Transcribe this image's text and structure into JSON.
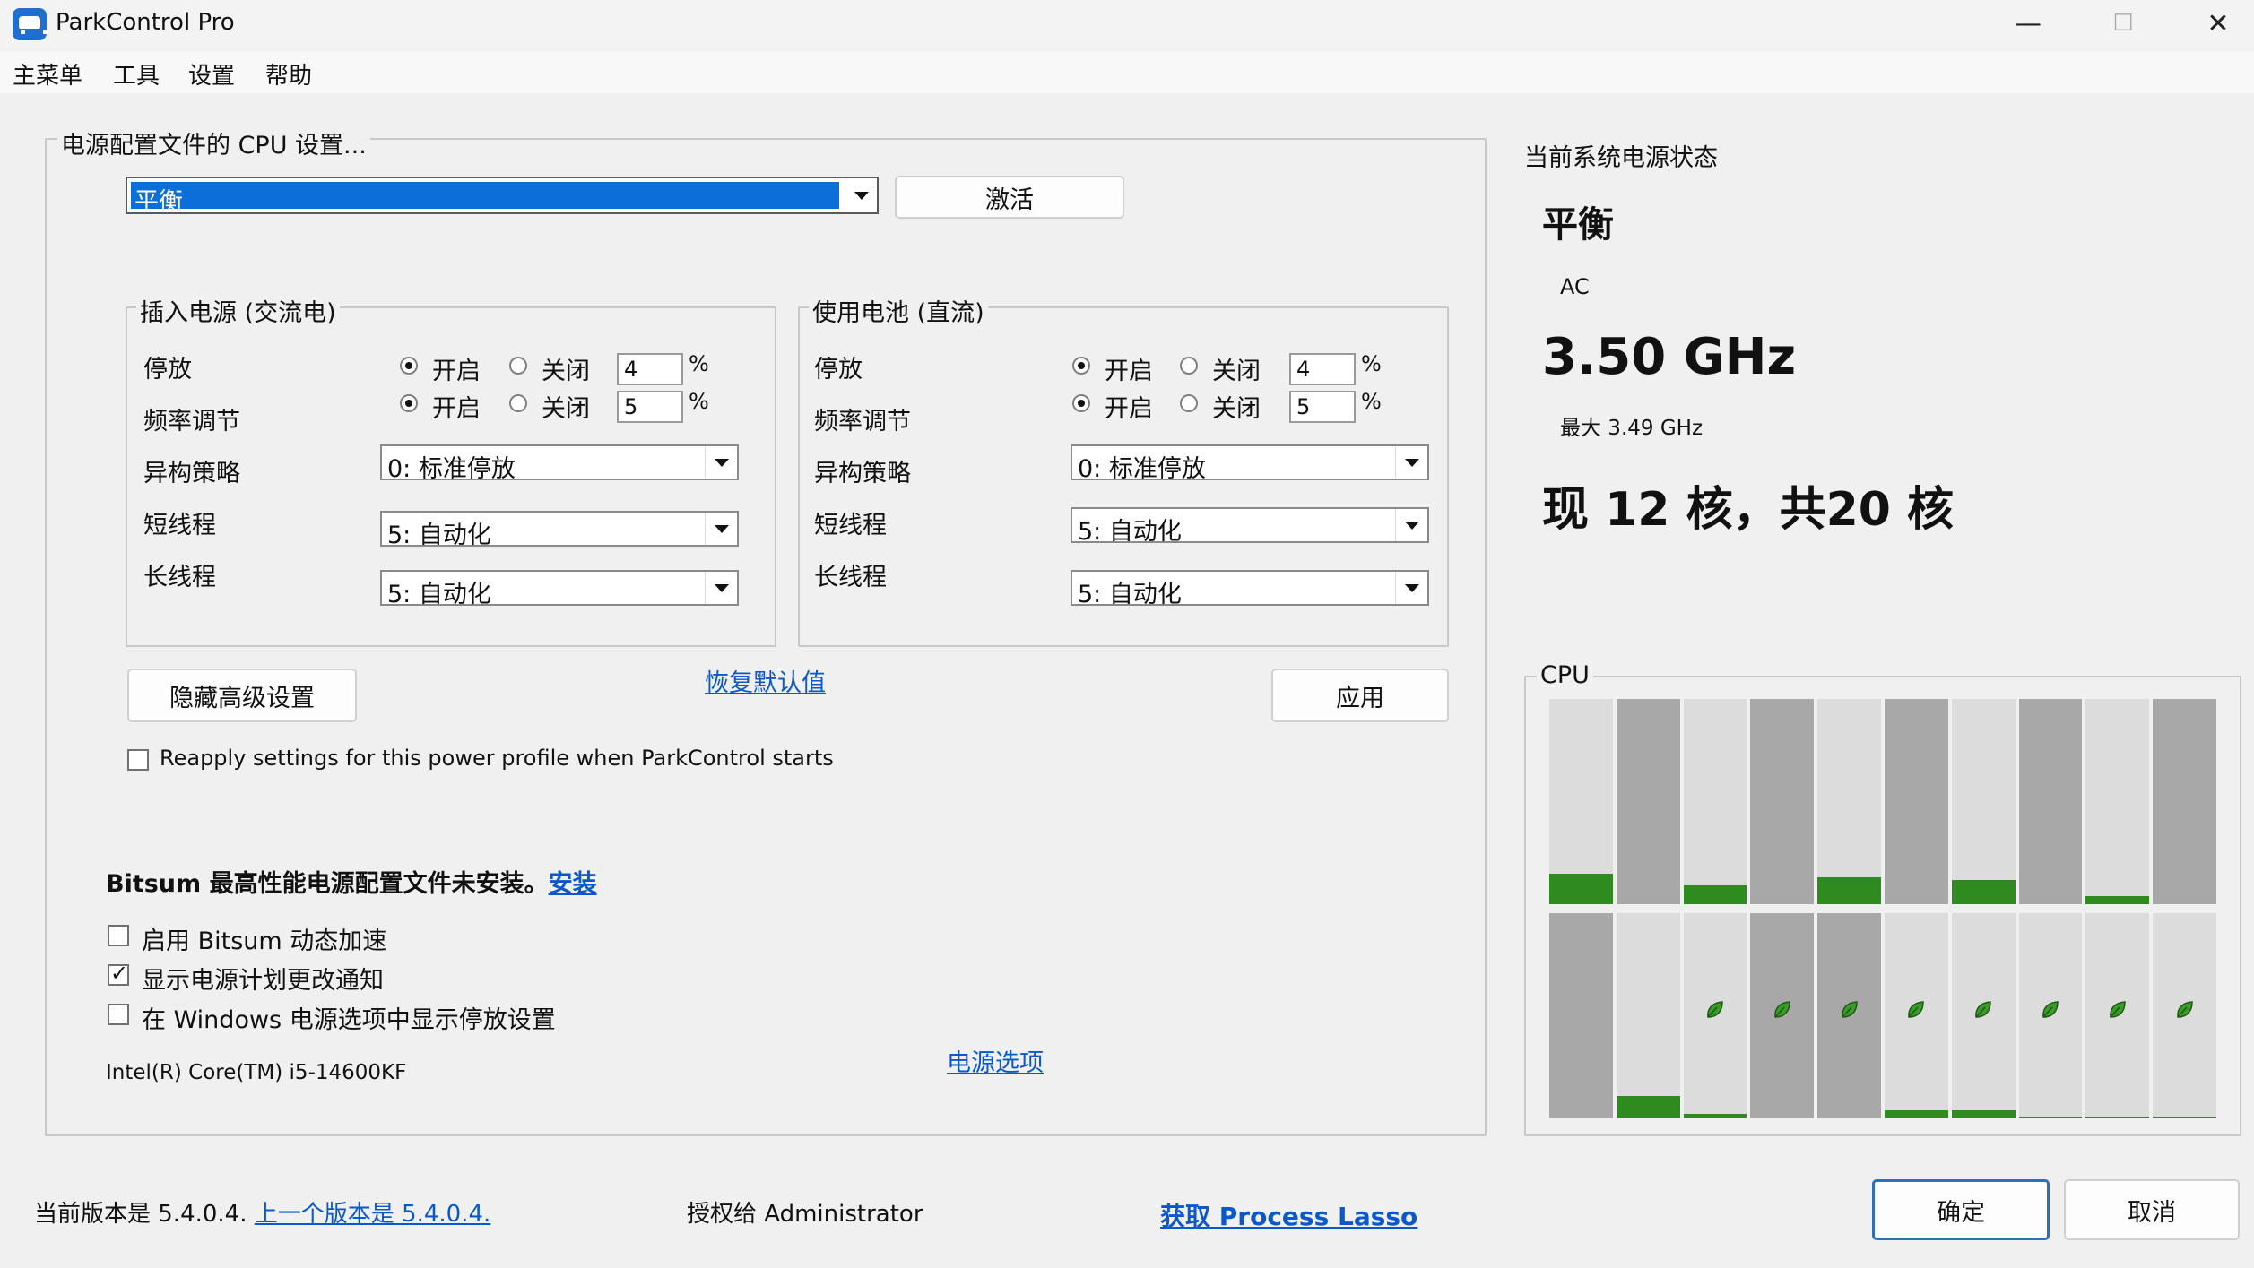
{
  "window": {
    "title": "ParkControl Pro",
    "min_glyph": "—",
    "max_glyph": "☐",
    "close_glyph": "✕"
  },
  "menu": [
    "主菜单",
    "工具",
    "设置",
    "帮助"
  ],
  "profile_group": {
    "legend": "电源配置文件的 CPU 设置...",
    "selected_profile": "平衡",
    "activate_label": "激活"
  },
  "ac_panel": {
    "legend": "插入电源 (交流电)",
    "rows": {
      "parking": "停放",
      "freq": "频率调节",
      "hetero": "异构策略",
      "short": "短线程",
      "long": "长线程"
    },
    "on_label": "开启",
    "off_label": "关闭",
    "parking_value": "4",
    "freq_value": "5",
    "pct": "%",
    "hetero_value": "0: 标准停放",
    "short_value": "5: 自动化",
    "long_value": "5: 自动化"
  },
  "dc_panel": {
    "legend": "使用电池 (直流)",
    "rows": {
      "parking": "停放",
      "freq": "频率调节",
      "hetero": "异构策略",
      "short": "短线程",
      "long": "长线程"
    },
    "on_label": "开启",
    "off_label": "关闭",
    "parking_value": "4",
    "freq_value": "5",
    "pct": "%",
    "hetero_value": "0: 标准停放",
    "short_value": "5: 自动化",
    "long_value": "5: 自动化"
  },
  "actions": {
    "hide_advanced": "隐藏高级设置",
    "restore_defaults": "恢复默认值",
    "apply": "应用",
    "reapply_checkbox": "Reapply settings for this power profile when ParkControl starts"
  },
  "bitsum": {
    "notice": "Bitsum 最高性能电源配置文件未安装。",
    "install_link": "安装",
    "dynamic_boost": "启用 Bitsum 动态加速",
    "show_notify": "显示电源计划更改通知",
    "show_windows": "在 Windows 电源选项中显示停放设置",
    "cpu_name": "Intel(R) Core(TM) i5-14600KF",
    "power_options_link": "电源选项"
  },
  "status": {
    "heading": "当前系统电源状态",
    "plan": "平衡",
    "source": "AC",
    "freq": "3.50 GHz",
    "max_freq": "最大 3.49 GHz",
    "cores": "现 12 核，共20 核"
  },
  "cpu_graph": {
    "legend": "CPU",
    "top_row": [
      {
        "parked": false,
        "load": 0.15
      },
      {
        "parked": true,
        "load": 0.0
      },
      {
        "parked": false,
        "load": 0.09
      },
      {
        "parked": true,
        "load": 0.0
      },
      {
        "parked": false,
        "load": 0.13
      },
      {
        "parked": true,
        "load": 0.0
      },
      {
        "parked": false,
        "load": 0.12
      },
      {
        "parked": true,
        "load": 0.0
      },
      {
        "parked": false,
        "load": 0.04
      },
      {
        "parked": true,
        "load": 0.0
      }
    ],
    "bottom_row": [
      {
        "parked": true,
        "load": 0.0,
        "eco": false
      },
      {
        "parked": false,
        "load": 0.11,
        "eco": false
      },
      {
        "parked": false,
        "load": 0.02,
        "eco": true
      },
      {
        "parked": true,
        "load": 0.0,
        "eco": true
      },
      {
        "parked": true,
        "load": 0.0,
        "eco": true
      },
      {
        "parked": false,
        "load": 0.04,
        "eco": true
      },
      {
        "parked": false,
        "load": 0.04,
        "eco": true
      },
      {
        "parked": false,
        "load": 0.01,
        "eco": true
      },
      {
        "parked": false,
        "load": 0.01,
        "eco": true
      },
      {
        "parked": false,
        "load": 0.01,
        "eco": true
      }
    ],
    "colors": {
      "idle": "#dcdcdc",
      "parked": "#a8a8a8",
      "load": "#2f8a1f",
      "leaf": "#3a9a2a"
    }
  },
  "footer": {
    "version_text": "当前版本是 5.4.0.4.",
    "prev_version_link": "上一个版本是 5.4.0.4.",
    "licensed": "授权给 Administrator",
    "get_lasso_link": "获取 Process Lasso",
    "ok": "确定",
    "cancel": "取消"
  }
}
